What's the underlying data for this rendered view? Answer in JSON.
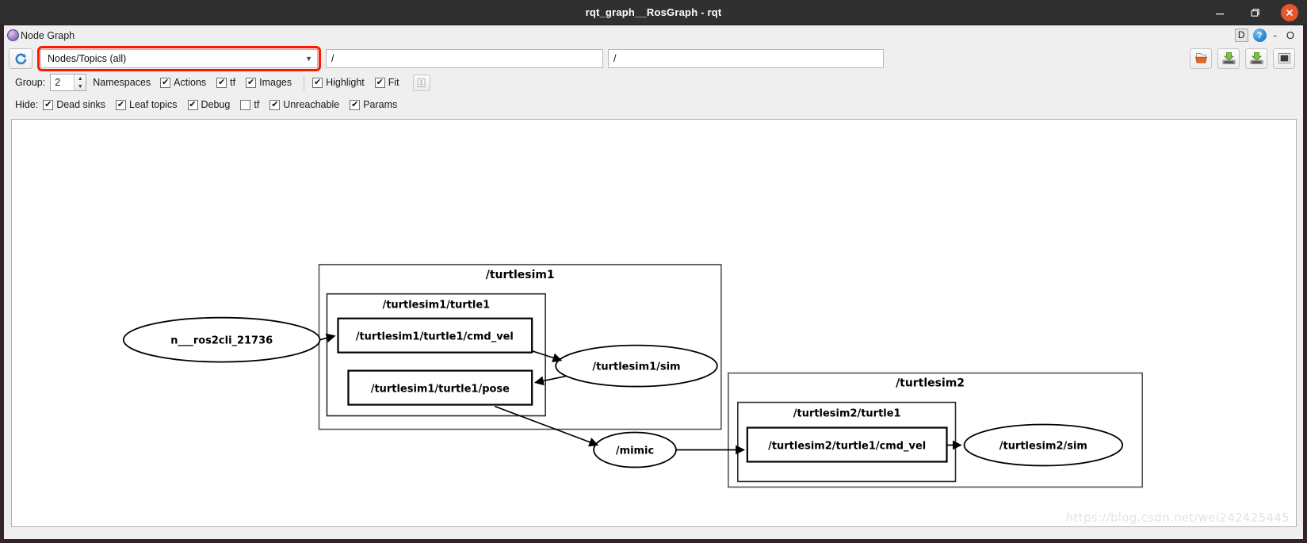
{
  "window": {
    "title": "rqt_graph__RosGraph - rqt",
    "controls": {
      "minimize": "minimize-icon",
      "maximize": "maximize-icon",
      "close": "close-icon"
    }
  },
  "dock": {
    "title": "Node Graph",
    "icon": "ros-node-graph-icon",
    "d_button": "D",
    "help": "?",
    "minimize": "-",
    "float": "O"
  },
  "toolbar": {
    "refresh_icon": "refresh-icon",
    "combo": {
      "value": "Nodes/Topics (all)",
      "arrow": "▼",
      "highlighted": true,
      "highlight_color": "#fb1800"
    },
    "filter_field_1": {
      "value": "/",
      "placeholder": ""
    },
    "filter_field_2": {
      "value": "/",
      "placeholder": ""
    },
    "right_buttons": [
      {
        "name": "load-dot-button",
        "icon": "open-folder-icon"
      },
      {
        "name": "save-dot-button",
        "icon": "save-dot-icon"
      },
      {
        "name": "save-image-button",
        "icon": "save-image-icon"
      },
      {
        "name": "fit-in-view-button",
        "icon": "fit-view-icon"
      }
    ]
  },
  "group_row": {
    "label": "Group:",
    "spin_value": "2",
    "namespaces_label": "Namespaces",
    "options": [
      {
        "label": "Actions",
        "checked": true
      },
      {
        "label": "tf",
        "checked": true
      },
      {
        "label": "Images",
        "checked": true
      }
    ],
    "right_options": [
      {
        "label": "Highlight",
        "checked": true
      },
      {
        "label": "Fit",
        "checked": true
      }
    ],
    "zoom_button_icon": "zoom-one-to-one-icon"
  },
  "hide_row": {
    "label": "Hide:",
    "options": [
      {
        "label": "Dead sinks",
        "checked": true
      },
      {
        "label": "Leaf topics",
        "checked": true
      },
      {
        "label": "Debug",
        "checked": true
      },
      {
        "label": "tf",
        "checked": false
      },
      {
        "label": "Unreachable",
        "checked": true
      },
      {
        "label": "Params",
        "checked": true
      }
    ]
  },
  "graph": {
    "watermark": "https://blog.csdn.net/wei242425445",
    "clusters": [
      {
        "id": "turtlesim1",
        "label": "/turtlesim1"
      },
      {
        "id": "turtlesim1_turtle1",
        "label": "/turtlesim1/turtle1"
      },
      {
        "id": "turtlesim2",
        "label": "/turtlesim2"
      },
      {
        "id": "turtlesim2_turtle1",
        "label": "/turtlesim2/turtle1"
      }
    ],
    "nodes": [
      {
        "id": "ros2cli",
        "label": "n___ros2cli_21736",
        "shape": "ellipse"
      },
      {
        "id": "sim1",
        "label": "/turtlesim1/sim",
        "shape": "ellipse"
      },
      {
        "id": "mimic",
        "label": "/mimic",
        "shape": "ellipse"
      },
      {
        "id": "sim2",
        "label": "/turtlesim2/sim",
        "shape": "ellipse"
      }
    ],
    "topics": [
      {
        "id": "cmd_vel1",
        "label": "/turtlesim1/turtle1/cmd_vel",
        "shape": "box"
      },
      {
        "id": "pose1",
        "label": "/turtlesim1/turtle1/pose",
        "shape": "box"
      },
      {
        "id": "cmd_vel2",
        "label": "/turtlesim2/turtle1/cmd_vel",
        "shape": "box"
      }
    ],
    "edges": [
      {
        "from": "ros2cli",
        "to": "cmd_vel1"
      },
      {
        "from": "cmd_vel1",
        "to": "sim1"
      },
      {
        "from": "sim1",
        "to": "pose1"
      },
      {
        "from": "pose1",
        "to": "mimic"
      },
      {
        "from": "mimic",
        "to": "cmd_vel2"
      },
      {
        "from": "cmd_vel2",
        "to": "sim2"
      }
    ]
  }
}
